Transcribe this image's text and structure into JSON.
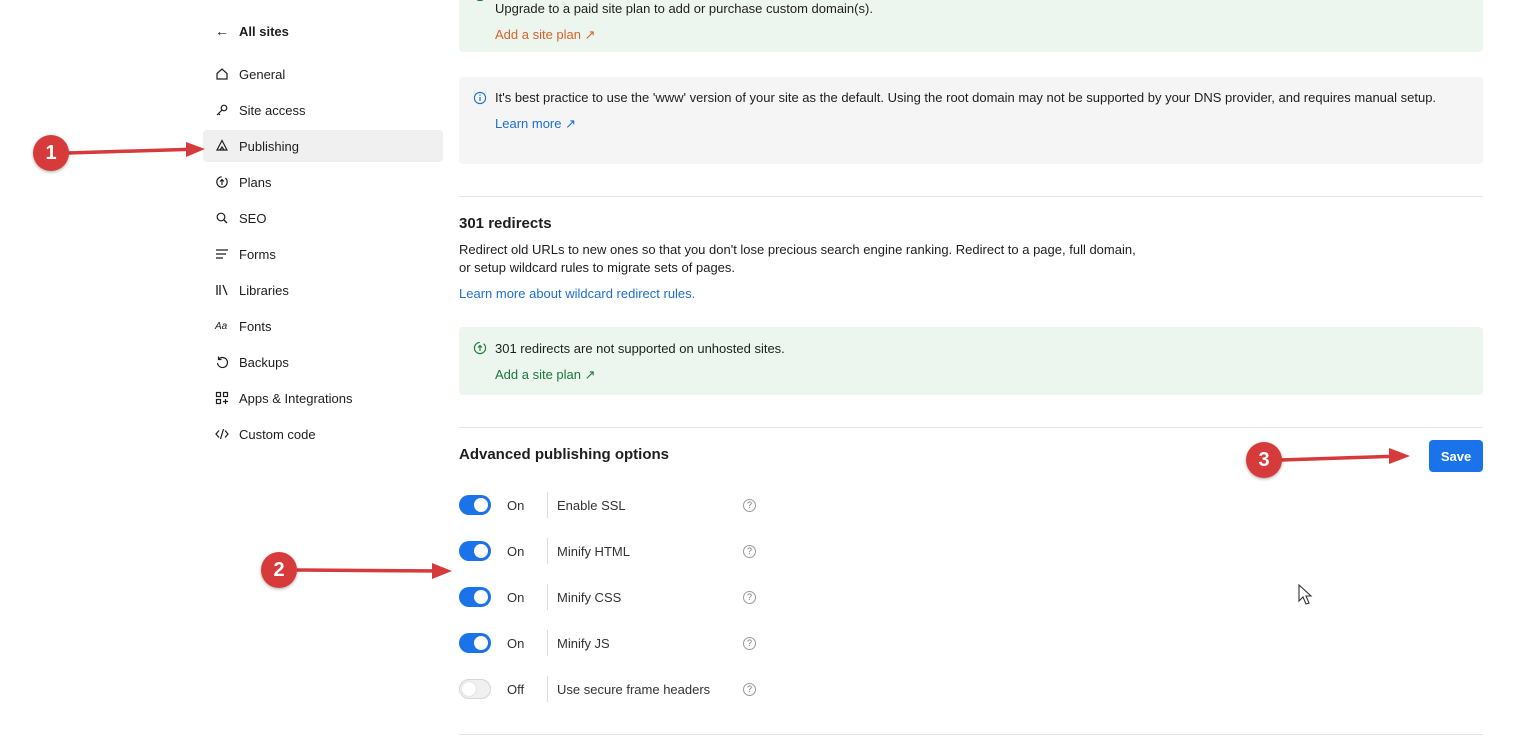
{
  "sidebar": {
    "back_label": "All sites",
    "items": [
      {
        "label": "General",
        "icon": "home-icon"
      },
      {
        "label": "Site access",
        "icon": "key-icon"
      },
      {
        "label": "Publishing",
        "icon": "publishing-icon",
        "active": true
      },
      {
        "label": "Plans",
        "icon": "plans-icon"
      },
      {
        "label": "SEO",
        "icon": "search-icon"
      },
      {
        "label": "Forms",
        "icon": "forms-icon"
      },
      {
        "label": "Libraries",
        "icon": "libraries-icon"
      },
      {
        "label": "Fonts",
        "icon": "fonts-icon"
      },
      {
        "label": "Backups",
        "icon": "backup-icon"
      },
      {
        "label": "Apps & Integrations",
        "icon": "apps-icon"
      },
      {
        "label": "Custom code",
        "icon": "code-icon"
      }
    ]
  },
  "domain_notice": {
    "text": "Upgrade to a paid site plan to add or purchase custom domain(s).",
    "link": "Add a site plan ↗"
  },
  "www_notice": {
    "text": "It's best practice to use the 'www' version of your site as the default. Using the root domain may not be supported by your DNS provider, and requires manual setup.",
    "link": "Learn more ↗"
  },
  "redirects": {
    "title": "301 redirects",
    "description": "Redirect old URLs to new ones so that you don't lose precious search engine ranking. Redirect to a page, full domain, or setup wildcard rules to migrate sets of pages.",
    "link": "Learn more about wildcard redirect rules.",
    "notice_text": "301 redirects are not supported on unhosted sites.",
    "notice_link": "Add a site plan ↗"
  },
  "advanced": {
    "title": "Advanced publishing options",
    "save_label": "Save",
    "options": [
      {
        "state": "On",
        "label": "Enable SSL",
        "on": true
      },
      {
        "state": "On",
        "label": "Minify HTML",
        "on": true
      },
      {
        "state": "On",
        "label": "Minify CSS",
        "on": true
      },
      {
        "state": "On",
        "label": "Minify JS",
        "on": true
      },
      {
        "state": "Off",
        "label": "Use secure frame headers",
        "on": false
      }
    ],
    "help_glyph": "?"
  },
  "annotations": [
    "1",
    "2",
    "3"
  ],
  "colors": {
    "accent": "#1a73e8",
    "annotation": "#d63a3a",
    "green_notice": "#edf6ee",
    "gray_notice": "#f5f5f5"
  }
}
